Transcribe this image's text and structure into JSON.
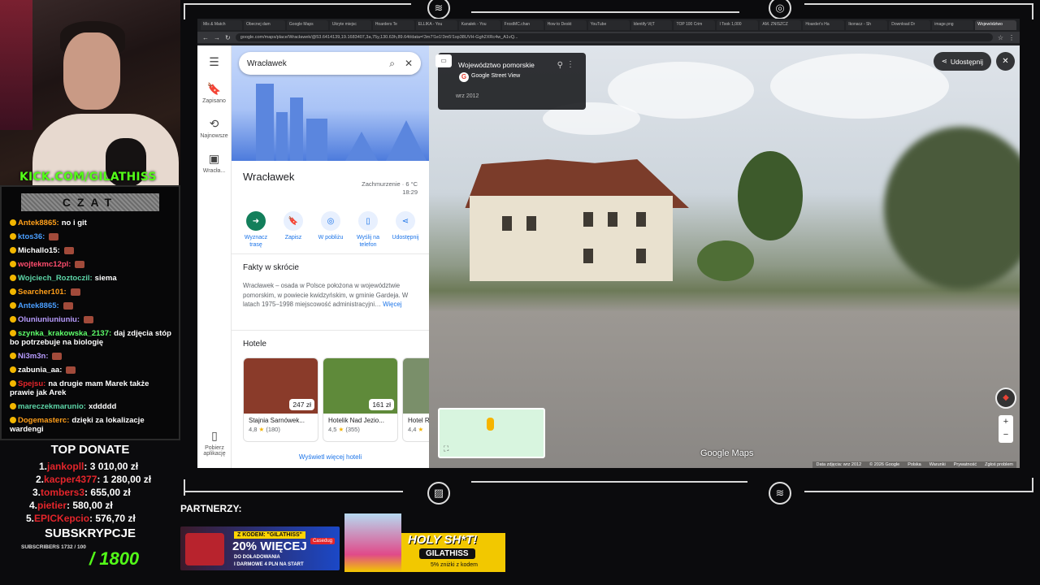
{
  "stream": {
    "kick_handle": "KICK.COM/GILATHISS",
    "chat_title": "CZAT",
    "chat_messages": [
      {
        "user": "Antek8865:",
        "color": "#ff9f1a",
        "text": "no i git"
      },
      {
        "user": "ktos36:",
        "color": "#4a9eff",
        "text": ""
      },
      {
        "user": "Michallo15:",
        "color": "#ffffff",
        "text": ""
      },
      {
        "user": "wojtekmc12pl:",
        "color": "#ff4d6d",
        "text": ""
      },
      {
        "user": "Wojciech_Roztoczil:",
        "color": "#5dd6a8",
        "text": "siema"
      },
      {
        "user": "Searcher101:",
        "color": "#ff9f1a",
        "text": ""
      },
      {
        "user": "Antek8865:",
        "color": "#4a9eff",
        "text": ""
      },
      {
        "user": "Oluniuniuniuniu:",
        "color": "#b89cff",
        "text": ""
      },
      {
        "user": "szynka_krakowska_2137:",
        "color": "#5dff6a",
        "text": "daj zdjęcia stóp bo potrzebuje na biologię"
      },
      {
        "user": "Ni3m3n:",
        "color": "#b89cff",
        "text": ""
      },
      {
        "user": "zabunia_aa:",
        "color": "#ffffff",
        "text": ""
      },
      {
        "user": "Spejsu:",
        "color": "#e4252b",
        "text": "na drugie mam Marek także prawie jak Arek"
      },
      {
        "user": "mareczekmarunio:",
        "color": "#5dd6a8",
        "text": "xddddd"
      },
      {
        "user": "Dogemasterc:",
        "color": "#ff9f1a",
        "text": "dzięki za lokalizacje wardengi"
      }
    ],
    "top_donate_title": "TOP DONATE",
    "donations": [
      {
        "rank": "1.",
        "name": "jankopll",
        "amount": "3 010,00 zł"
      },
      {
        "rank": "2.",
        "name": "kacper4377",
        "amount": "1 280,00 zł"
      },
      {
        "rank": "3.",
        "name": "tombers3",
        "amount": "655,00 zł"
      },
      {
        "rank": "4.",
        "name": "pietier",
        "amount": "580,00 zł"
      },
      {
        "rank": "5.",
        "name": "EPICKepcio",
        "amount": "576,70 zł"
      }
    ],
    "subs_title": "SUBSKRYPCJE",
    "subs_small": "SUBSCRIBERS 1732 / 100",
    "subs_goal": "/ 1800",
    "partners_label": "PARTNERZY:",
    "banner1": {
      "code": "Z KODEM: \"GILATHISS\"",
      "headline": "20% WIĘCEJ",
      "sub1": "DO DOŁADOWANIA",
      "sub2": "I DARMOWE 4 PLN NA START",
      "brand": "Casedug"
    },
    "banner2": {
      "headline": "HOLY SH*T!",
      "code": "GILATHISS",
      "sub": "5% zniżki z kodem"
    }
  },
  "browser": {
    "tabs": [
      "Mis & Match",
      "Obecnej dam",
      "Google Maps",
      "Ukryte miejsc",
      "Hoarders Te",
      "ELLIKA - You",
      "Kanałek - You",
      "FrostMC.chan",
      "How to Deskt",
      "YouTube",
      "Identify Vi|T",
      "TOP 100 Crim",
      "I Took 1,000",
      "AM. ZNISZCZ",
      "Hoarder's Ha",
      "Ikonacz - Sh",
      "Download Dr",
      "image.png",
      "Województwo"
    ],
    "active_tab": 18,
    "url": "google.com/maps/place/Wracławek/@53.6414139,19.1683407,3a,75y,130.63h,89.64t/data=!3m7!1e1!3m5!1sp38UVH-Ggh2XRc4w_A1vQ..."
  },
  "maps": {
    "rail": [
      {
        "icon": "☰",
        "label": ""
      },
      {
        "icon": "🔖",
        "label": "Zapisano"
      },
      {
        "icon": "⟲",
        "label": "Najnowsze"
      },
      {
        "icon": "▣",
        "label": "Wracła..."
      }
    ],
    "rail_bottom": "Pobierz aplikację",
    "search_value": "Wracławek",
    "place_title": "Wracławek",
    "weather_desc": "Zachmurzenie · 6 °C",
    "weather_time": "18:29",
    "actions": [
      "Wyznacz trasę",
      "Zapisz",
      "W pobliżu",
      "Wyślij na telefon",
      "Udostępnij"
    ],
    "facts_heading": "Fakty w skrócie",
    "facts_text": "Wracławek – osada w Polsce położona w województwie pomorskim, w powiecie kwidzyńskim, w gminie Gardeja. W latach 1975–1998 miejscowość administracyjni…",
    "facts_more": "Więcej",
    "hotels_heading": "Hotele",
    "hotels": [
      {
        "name": "Stajnia Sarnówek...",
        "price": "247 zł",
        "rating": "4,8",
        "reviews": "(180)",
        "color": "#8a3b2a"
      },
      {
        "name": "Hotelik Nad Jezio...",
        "price": "161 zł",
        "rating": "4,5",
        "reviews": "(355)",
        "color": "#5f8a3a"
      },
      {
        "name": "Hotel R",
        "price": "",
        "rating": "4,4",
        "reviews": "",
        "color": "#7a8f6a"
      }
    ],
    "more_hotels": "Wyświetl więcej hoteli",
    "sv": {
      "region": "Województwo pomorskie",
      "source": "Google Street View",
      "date": "wrz 2012",
      "share": "Udostępnij",
      "logo": "Google Maps",
      "attribution": [
        "Data zdjęcia: wrz 2012",
        "© 2026 Google",
        "Polska",
        "Warunki",
        "Prywatność",
        "Zgłoś problem"
      ]
    }
  }
}
